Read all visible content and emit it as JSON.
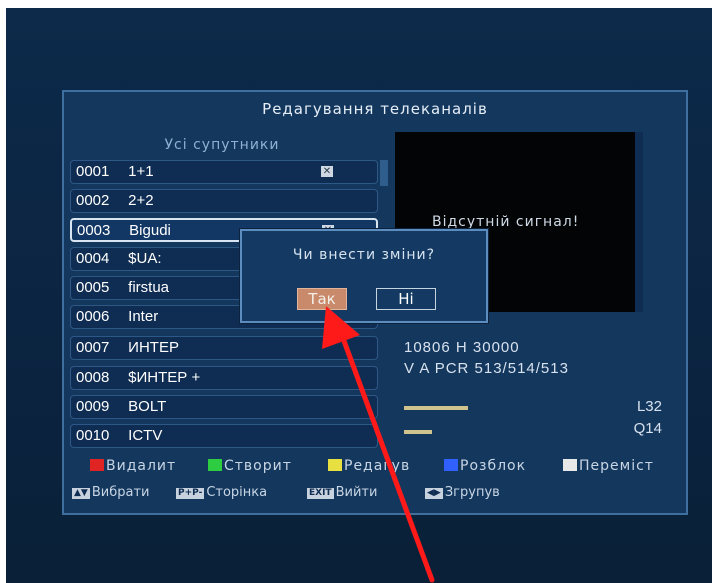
{
  "title": "Редагування телеканалів",
  "list_header": "Усі супутники",
  "channels": [
    {
      "num": "0001",
      "name": "1+1",
      "deleted": true
    },
    {
      "num": "0002",
      "name": "2+2",
      "deleted": false
    },
    {
      "num": "0003",
      "name": "Bigudi",
      "deleted": true,
      "selected": true
    },
    {
      "num": "0004",
      "name": "$UA:",
      "deleted": false
    },
    {
      "num": "0005",
      "name": "firstua",
      "deleted": false
    },
    {
      "num": "0006",
      "name": "Inter",
      "deleted": false
    },
    {
      "num": "0007",
      "name": "ИНТЕР",
      "deleted": false
    },
    {
      "num": "0008",
      "name": "$ИНТЕР +",
      "deleted": false
    },
    {
      "num": "0009",
      "name": "BOLT",
      "deleted": false
    },
    {
      "num": "0010",
      "name": "ICTV",
      "deleted": false
    }
  ],
  "preview": {
    "no_signal": "Відсутній сигнал!",
    "tp_line": "10806  H  30000",
    "pid_line": "V  A  PCR  513/514/513",
    "level_label": "L32",
    "quality_label": "Q14",
    "level": 0.32,
    "quality": 0.14
  },
  "legend": [
    {
      "label": "Видалит",
      "color": "#e02424"
    },
    {
      "label": "Створит",
      "color": "#2ecc40"
    },
    {
      "label": "Редагув",
      "color": "#e8e040"
    },
    {
      "label": "Розблок",
      "color": "#3060ff"
    },
    {
      "label": "Переміст",
      "color": "#e8e8e8"
    }
  ],
  "hotkeys": [
    {
      "key": "▲▼",
      "label": "Вибрати"
    },
    {
      "key": "P+P-",
      "label": "Сторінка"
    },
    {
      "key": "EXIT",
      "label": "Вийти"
    },
    {
      "key": "◀▶",
      "label": "Згрупув"
    }
  ],
  "dialog": {
    "question": "Чи внести зміни?",
    "yes": "Так",
    "no": "Ні"
  },
  "annotation_color": "#ff1a1a",
  "icons": {
    "delete_mark": "x-icon"
  }
}
